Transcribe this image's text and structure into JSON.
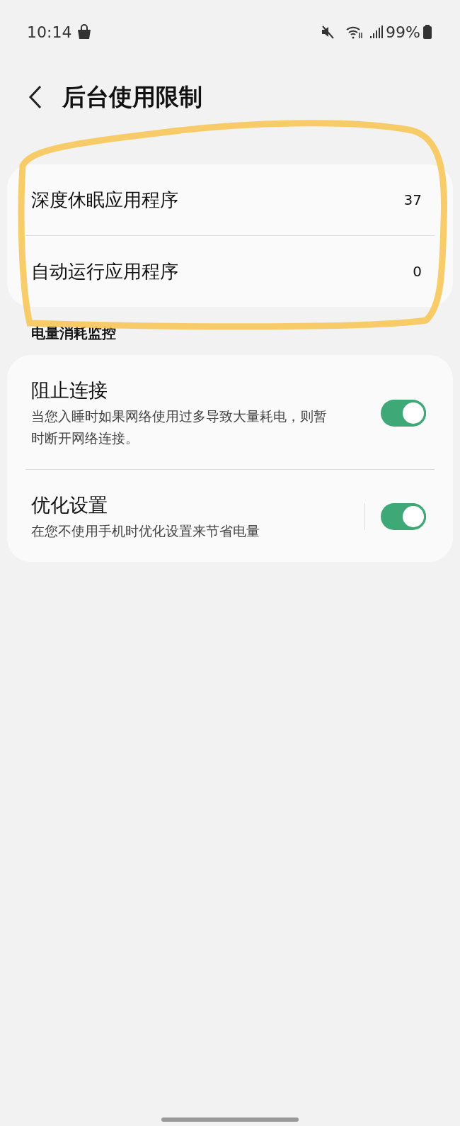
{
  "status_bar": {
    "time": "10:14",
    "battery": "99%"
  },
  "header": {
    "title": "后台使用限制"
  },
  "limit_items": [
    {
      "label": "深度休眠应用程序",
      "count": "37"
    },
    {
      "label": "自动运行应用程序",
      "count": "0"
    }
  ],
  "section": {
    "title": "电量消耗监控"
  },
  "monitor_items": [
    {
      "title": "阻止连接",
      "description": "当您入睡时如果网络使用过多导致大量耗电，则暂时断开网络连接。",
      "on": true,
      "split": false
    },
    {
      "title": "优化设置",
      "description": "在您不使用手机时优化设置来节省电量",
      "on": true,
      "split": true
    }
  ]
}
